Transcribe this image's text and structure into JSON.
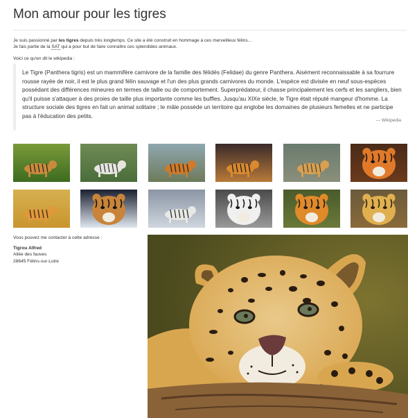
{
  "page": {
    "title": "Mon amour pour les tigres"
  },
  "intro": {
    "line1_a": "Je suis passionné par ",
    "line1_b": "les tigres",
    "line1_c": " depuis très longtemps. Ce site a été construit en hommage à ces merveilleux félins...",
    "line2_a": "Je fais partie de la ",
    "line2_abbr": "SAT",
    "line2_b": " qui a pour but de faire connaître ces splendides animaux."
  },
  "wikipedia": {
    "lead": "Voici ce qu'en dit le wikipedia :",
    "quote": "Le Tigre (Panthera tigris) est un mammifère carnivore de la famille des félidés (Felidae) du genre Panthera. Aisément reconnaissable à sa fourrure rousse rayée de noir, il est le plus grand félin sauvage et l'un des plus grands carnivores du monde. L'espèce est divisée en neuf sous-espèces possédant des différences mineures en termes de taille ou de comportement. Superprédateur, il chasse principalement les cerfs et les sangliers, bien qu'il puisse s'attaquer à des proies de taille plus importante comme les buffles. Jusqu'au XIXe siècle, le Tigre était réputé mangeur d'homme. La structure sociale des tigres en fait un animal solitaire ; le mâle possède un territoire qui englobe les domaines de plusieurs femelles et ne participe pas à l'éducation des petits.",
    "source": "— Wikipedia"
  },
  "gallery": {
    "thumbnails": [
      {
        "name": "tiger-photo-1",
        "sky": "#7a9a3a",
        "ground": "#3d6b1f",
        "animal": "#c98a3e",
        "accent": "#2b2b1a"
      },
      {
        "name": "tiger-photo-2",
        "sky": "#6f8b55",
        "ground": "#4a6d3a",
        "animal": "#e6e6e0",
        "accent": "#3a3a3a"
      },
      {
        "name": "tiger-photo-3",
        "sky": "#8fa7b0",
        "ground": "#6d7a5a",
        "animal": "#d07a2a",
        "accent": "#2a2a2a"
      },
      {
        "name": "tiger-photo-4",
        "sky": "#3a2a2a",
        "ground": "#b87a3a",
        "animal": "#d9892e",
        "accent": "#1e1e1e"
      },
      {
        "name": "tiger-photo-5",
        "sky": "#6a7b6e",
        "ground": "#8a8f7a",
        "animal": "#d8a050",
        "accent": "#4a4a40"
      },
      {
        "name": "tiger-photo-6",
        "sky": "#4a2a18",
        "ground": "#6b3a1c",
        "animal": "#e07a2a",
        "accent": "#1a1410"
      },
      {
        "name": "tiger-photo-7",
        "sky": "#d6b050",
        "ground": "#c9952e",
        "animal": "#e0983a",
        "accent": "#3a2a1a"
      },
      {
        "name": "tiger-photo-8",
        "sky": "#1a2030",
        "ground": "#dfe6ee",
        "animal": "#c8843a",
        "accent": "#111111"
      },
      {
        "name": "tiger-photo-9",
        "sky": "#8b95a5",
        "ground": "#cfd6de",
        "animal": "#e8e8e4",
        "accent": "#2a2a2a"
      },
      {
        "name": "tiger-photo-10",
        "sky": "#4a4a4a",
        "ground": "#9a9a9a",
        "animal": "#f0f0f0",
        "accent": "#1a1a1a"
      },
      {
        "name": "tiger-photo-11",
        "sky": "#4a5a2a",
        "ground": "#6a7a3a",
        "animal": "#e08a2a",
        "accent": "#1a1a1a"
      },
      {
        "name": "tiger-photo-12",
        "sky": "#6a5a3a",
        "ground": "#8a6a3a",
        "animal": "#e0b050",
        "accent": "#2a2010"
      }
    ]
  },
  "contact": {
    "lead": "Vous pouvez me contacter à cette adresse :",
    "name": "Tigrou Alfred",
    "street": "Allée des fauves",
    "city": "28645 Félins-sur-Loire"
  },
  "featured_photo": {
    "name": "jaguar-photo",
    "colors": {
      "background": "#4b4a1e",
      "background_light": "#7d7330",
      "fur": "#d9a650",
      "fur_light": "#e9c98a",
      "spot": "#2a1c10",
      "muzzle": "#f2ece0",
      "nose": "#6b3a3a",
      "eye": "#6a7a5a",
      "log": "#8a6238",
      "log_dark": "#5a3c22"
    }
  },
  "colors": {
    "text": "#333333",
    "muted": "#777777",
    "rule": "#e6e6e6",
    "quote_border": "#eeeeee"
  }
}
